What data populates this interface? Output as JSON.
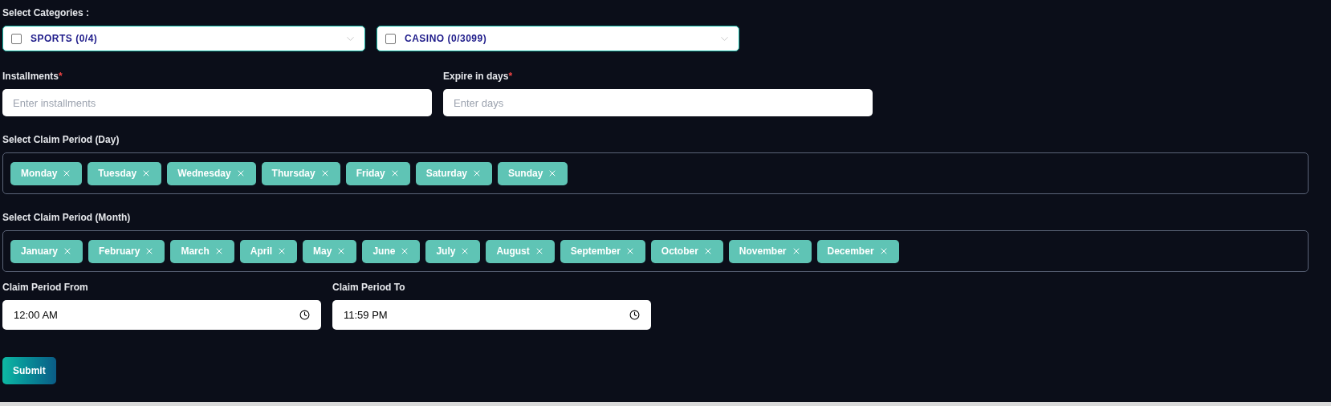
{
  "categories": {
    "label": "Select Categories :",
    "dropdowns": [
      {
        "label": "SPORTS (0/4)",
        "checked": false
      },
      {
        "label": "CASINO (0/3099)",
        "checked": false
      }
    ]
  },
  "inputs": [
    {
      "label": "Installments",
      "required_mark": "*",
      "placeholder": "Enter installments"
    },
    {
      "label": "Expire in days",
      "required_mark": "*",
      "placeholder": "Enter days"
    }
  ],
  "day_select": {
    "label": "Select Claim Period (Day)",
    "chips": [
      "Monday",
      "Tuesday",
      "Wednesday",
      "Thursday",
      "Friday",
      "Saturday",
      "Sunday"
    ]
  },
  "month_select": {
    "label": "Select Claim Period (Month)",
    "chips": [
      "January",
      "February",
      "March",
      "April",
      "May",
      "June",
      "July",
      "August",
      "September",
      "October",
      "November",
      "December"
    ]
  },
  "time_fields": [
    {
      "label": "Claim Period From",
      "value": "12:00 AM"
    },
    {
      "label": "Claim Period To",
      "value": "11:59 PM"
    }
  ],
  "submit": "Submit"
}
